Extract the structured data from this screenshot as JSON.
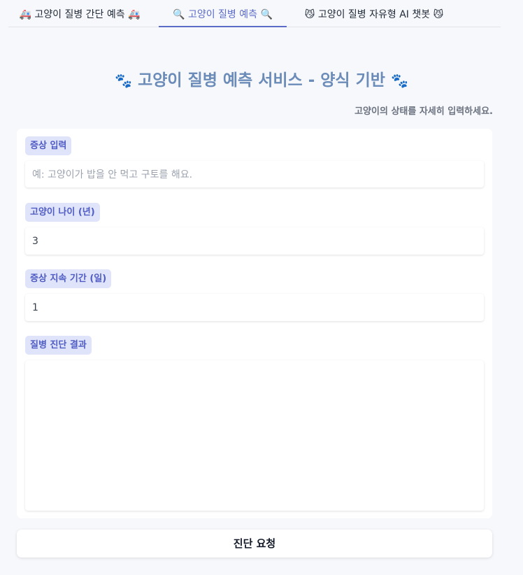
{
  "tabs": [
    {
      "label": "🚑 고양이 질병 간단 예측 🚑",
      "active": false
    },
    {
      "label": "🔍 고양이 질병 예측 🔍",
      "active": true
    },
    {
      "label": "😼 고양이 질병 자유형 AI 챗봇 😼",
      "active": false
    }
  ],
  "header": {
    "paw_left": "🐾",
    "title": "고양이 질병 예측 서비스 - 양식 기반",
    "paw_right": "🐾",
    "subtitle": "고양이의 상태를 자세히 입력하세요."
  },
  "form": {
    "symptom": {
      "label": "증상 입력",
      "value": "",
      "placeholder": "예: 고양이가 밥을 안 먹고 구토를 해요."
    },
    "age": {
      "label": "고양이 나이 (년)",
      "value": "3"
    },
    "duration": {
      "label": "증상 지속 기간 (일)",
      "value": "1"
    },
    "result": {
      "label": "질병 진단 결과",
      "value": ""
    }
  },
  "submit_label": "진단 요청",
  "colors": {
    "accent": "#5b6cc7",
    "title": "#6b8bb8",
    "label_bg": "#e0e4fb"
  }
}
